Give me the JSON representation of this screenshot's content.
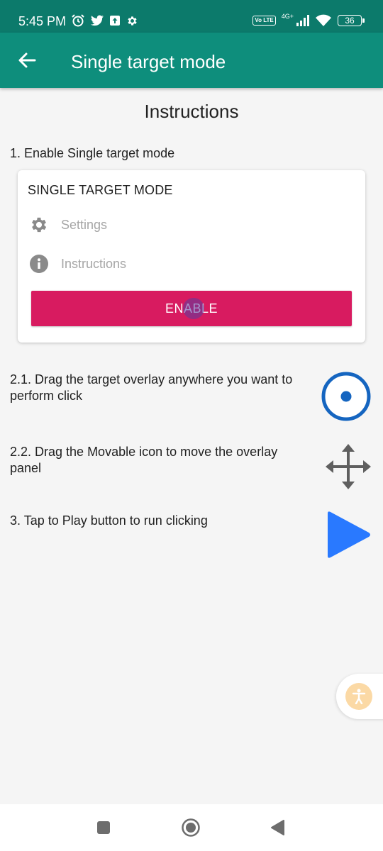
{
  "status_bar": {
    "time": "5:45 PM",
    "left_icons": [
      "alarm-icon",
      "twitter-icon",
      "upload-icon",
      "settings-icon"
    ],
    "volte_label": "Vo LTE",
    "network_type": "4G+",
    "battery_level": "36"
  },
  "app_bar": {
    "title": "Single target mode",
    "back_icon": "arrow-back-icon"
  },
  "main": {
    "page_title": "Instructions",
    "step1": "1. Enable Single target mode",
    "card": {
      "title": "SINGLE TARGET MODE",
      "settings_label": "Settings",
      "instructions_label": "Instructions",
      "enable_label": "ENABLE"
    },
    "step2_1": "2.1. Drag the target overlay anywhere you want to perform click",
    "step2_2": "2.2. Drag the Movable icon to move the overlay panel",
    "step3": "3. Tap to Play button to run clicking"
  },
  "colors": {
    "status_bar": "#0c7a6b",
    "app_bar": "#0e8e7c",
    "enable_button": "#d81b60",
    "target_blue": "#1565c0",
    "play_blue": "#2979ff",
    "accessibility_fab": "#fbd9a5"
  }
}
